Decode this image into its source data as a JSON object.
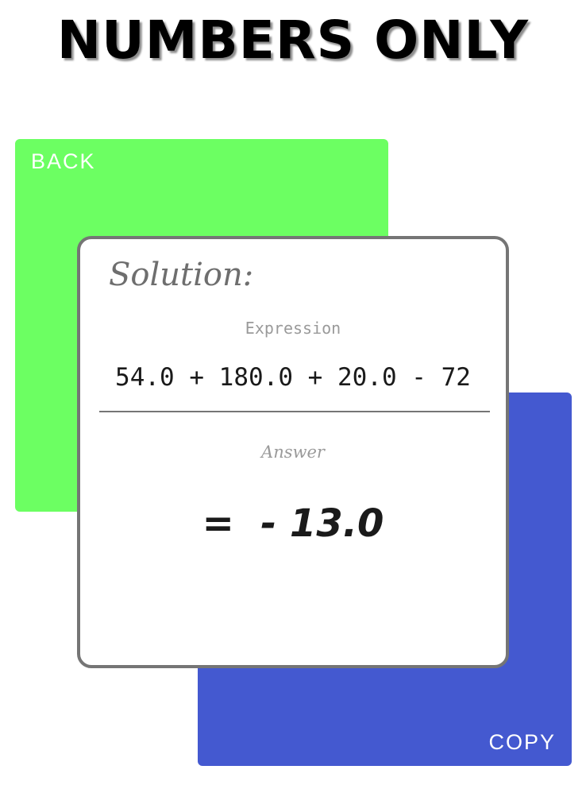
{
  "app": {
    "title": "NUMBERS ONLY"
  },
  "back_card": {
    "label": "BACK",
    "color": "#6cff62"
  },
  "copy_card": {
    "label": "COPY",
    "color": "#4459d0"
  },
  "solution": {
    "heading": "Solution:",
    "expression_caption": "Expression",
    "expression": "54.0 + 180.0 + 20.0 - 72",
    "answer_caption": "Answer",
    "answer": "=  - 13.0"
  }
}
